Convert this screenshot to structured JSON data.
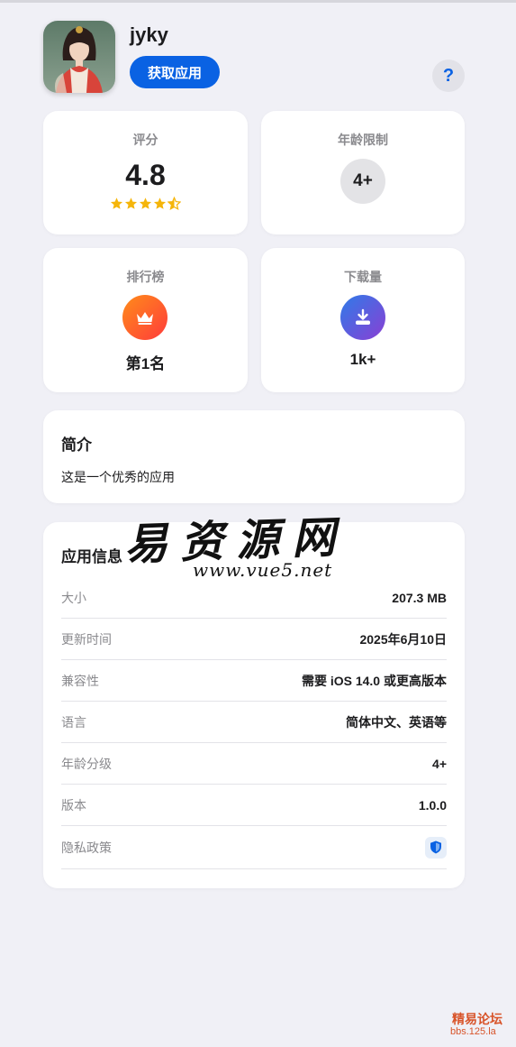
{
  "app": {
    "name": "jyky",
    "get_button": "获取应用",
    "help": "?"
  },
  "stats": {
    "rating": {
      "label": "评分",
      "value": "4.8",
      "stars": 4.5
    },
    "age": {
      "label": "年龄限制",
      "value": "4+"
    },
    "rank": {
      "label": "排行榜",
      "value": "第1名",
      "icon": "crown-icon"
    },
    "downloads": {
      "label": "下载量",
      "value": "1k+",
      "icon": "download-icon"
    }
  },
  "intro": {
    "title": "简介",
    "text": "这是一个优秀的应用"
  },
  "info": {
    "title": "应用信息",
    "rows": [
      {
        "key": "大小",
        "value": "207.3 MB"
      },
      {
        "key": "更新时间",
        "value": "2025年6月10日"
      },
      {
        "key": "兼容性",
        "value": "需要 iOS 14.0 或更高版本"
      },
      {
        "key": "语言",
        "value": "简体中文、英语等"
      },
      {
        "key": "年龄分级",
        "value": "4+"
      },
      {
        "key": "版本",
        "value": "1.0.0"
      },
      {
        "key": "隐私政策",
        "value": "",
        "icon": "shield-icon"
      }
    ]
  },
  "watermark": {
    "title": "易资源网",
    "url": "www.vue5.net",
    "forum_name": "精易论坛",
    "forum_url": "bbs.125.la"
  },
  "colors": {
    "accent": "#0a62e3",
    "star": "#f5b50a",
    "background": "#f0f0f6"
  }
}
